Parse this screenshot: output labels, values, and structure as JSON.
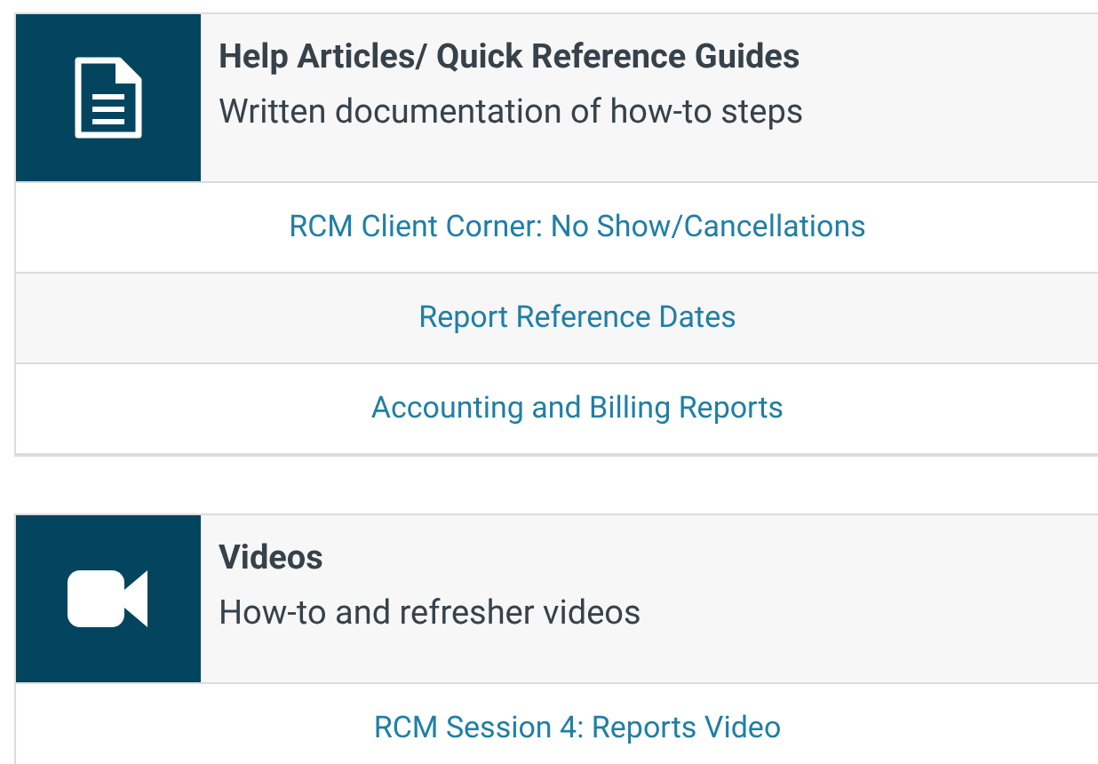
{
  "sections": [
    {
      "kind": "document",
      "title": "Help Articles/ Quick Reference Guides",
      "subtitle": "Written documentation of how-to steps",
      "links": [
        "RCM Client Corner: No Show/Cancellations",
        "Report Reference Dates",
        "Accounting and Billing Reports"
      ]
    },
    {
      "kind": "video",
      "title": "Videos",
      "subtitle": "How-to and refresher videos",
      "links": [
        "RCM Session 4: Reports Video"
      ]
    }
  ]
}
